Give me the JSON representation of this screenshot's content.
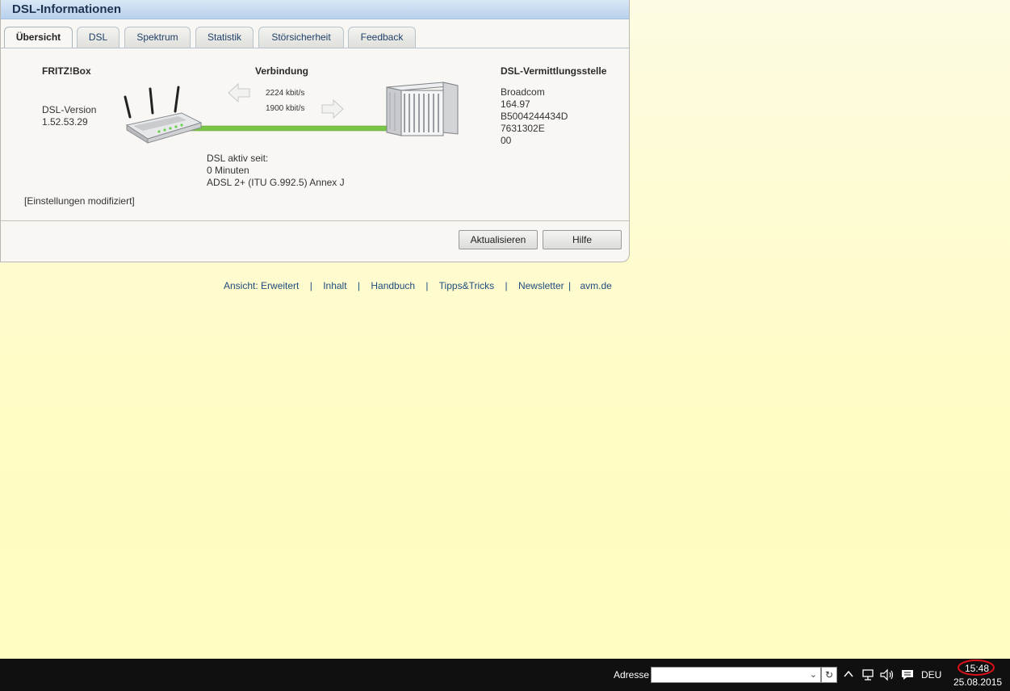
{
  "window": {
    "title": "DSL-Informationen"
  },
  "tabs": [
    {
      "label": "Übersicht",
      "active": true
    },
    {
      "label": "DSL"
    },
    {
      "label": "Spektrum"
    },
    {
      "label": "Statistik"
    },
    {
      "label": "Störsicherheit"
    },
    {
      "label": "Feedback"
    }
  ],
  "fritzbox": {
    "heading": "FRITZ!Box",
    "version_label": "DSL-Version",
    "version": "1.52.53.29"
  },
  "connection": {
    "heading": "Verbindung",
    "downstream": "2224 kbit/s",
    "upstream": "1900 kbit/s"
  },
  "exchange": {
    "heading": "DSL-Vermittlungsstelle",
    "lines": [
      "Broadcom",
      "164.97",
      "B5004244434D",
      "7631302E",
      "00"
    ]
  },
  "status": {
    "active_since_label": "DSL aktiv seit:",
    "duration": "0 Minuten",
    "mode": "ADSL 2+ (ITU G.992.5) Annex J"
  },
  "settings_note": "[Einstellungen modifiziert]",
  "buttons": {
    "refresh": "Aktualisieren",
    "help": "Hilfe"
  },
  "footer": {
    "view_label": "Ansicht:",
    "view_value": "Erweitert",
    "links": [
      "Inhalt",
      "Handbuch",
      "Tipps&Tricks",
      "Newsletter"
    ],
    "last_link": "avm.de"
  },
  "taskbar": {
    "address_label": "Adresse",
    "address_value": "",
    "language": "DEU",
    "time": "15:48",
    "date": "25.08.2015"
  },
  "colors": {
    "line": "#78c548",
    "time_highlight": "#e0101a"
  },
  "icons": [
    "router-icon",
    "dsl-exchange-icon",
    "arrow-left-icon",
    "arrow-right-icon",
    "chevron-up-icon",
    "network-icon",
    "volume-icon",
    "notification-icon",
    "refresh-icon",
    "dropdown-icon"
  ]
}
